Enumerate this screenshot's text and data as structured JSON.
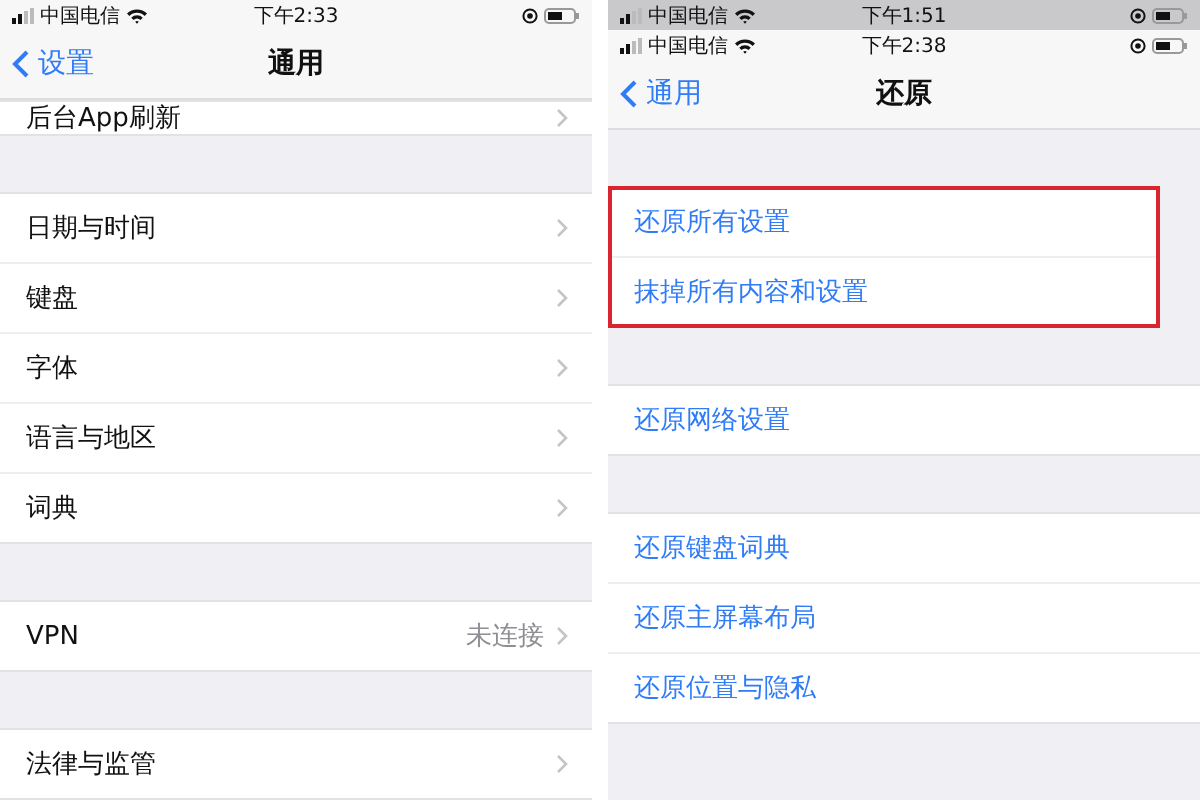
{
  "panels": [
    {
      "status_bars": [
        {
          "carrier": "中国电信",
          "time": "下午2:33",
          "dimmed": false
        }
      ],
      "nav": {
        "back": "设置",
        "title": "通用"
      },
      "groups": [
        {
          "highlighted": false,
          "cut": true,
          "items": [
            {
              "label": "后台App刷新"
            }
          ]
        },
        {
          "highlighted": false,
          "cut": false,
          "items": [
            {
              "label": "日期与时间"
            },
            {
              "label": "键盘"
            },
            {
              "label": "字体"
            },
            {
              "label": "语言与地区"
            },
            {
              "label": "词典"
            }
          ]
        },
        {
          "highlighted": false,
          "cut": false,
          "items": [
            {
              "label": "VPN",
              "value": "未连接"
            }
          ]
        },
        {
          "highlighted": false,
          "cut": false,
          "items": [
            {
              "label": "法律与监管"
            }
          ]
        }
      ]
    },
    {
      "status_bars": [
        {
          "carrier": "中国电信",
          "time": "下午1:51",
          "dimmed": true
        },
        {
          "carrier": "中国电信",
          "time": "下午2:38",
          "dimmed": false
        }
      ],
      "nav": {
        "back": "通用",
        "title": "还原"
      },
      "groups": [
        {
          "highlighted": true,
          "cut": false,
          "items": [
            {
              "label": "还原所有设置",
              "action": true
            },
            {
              "label": "抹掉所有内容和设置",
              "action": true
            }
          ]
        },
        {
          "highlighted": false,
          "cut": false,
          "items": [
            {
              "label": "还原网络设置",
              "action": true
            }
          ]
        },
        {
          "highlighted": false,
          "cut": false,
          "items": [
            {
              "label": "还原键盘词典",
              "action": true
            },
            {
              "label": "还原主屏幕布局",
              "action": true
            },
            {
              "label": "还原位置与隐私",
              "action": true
            }
          ]
        }
      ]
    }
  ]
}
